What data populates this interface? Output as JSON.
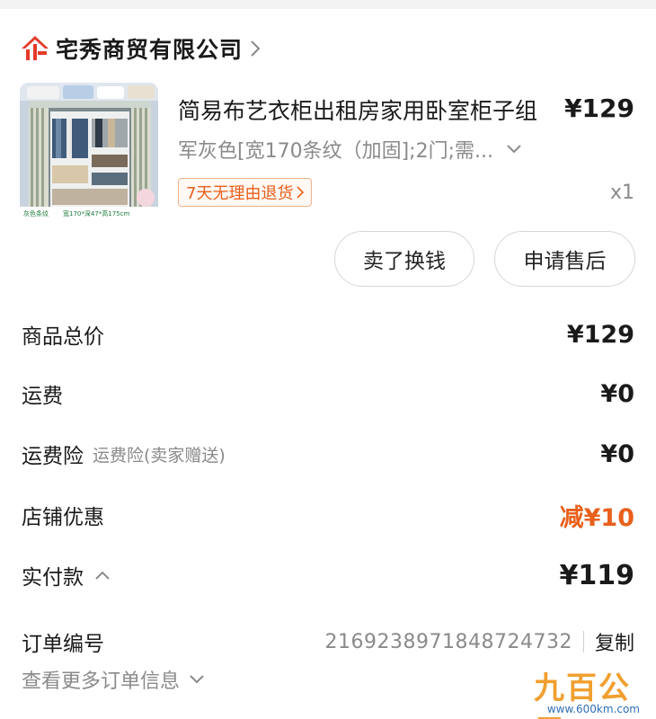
{
  "shop": {
    "name": "宅秀商贸有限公司",
    "icon": "enterprise-icon",
    "icon_color": "#e53a2a"
  },
  "product": {
    "title": "简易布艺衣柜出租房家用卧室柜子组",
    "price": "¥129",
    "spec": "军灰色[宽170条纹（加固];2门;需...",
    "return_badge": "7天无理由退货",
    "quantity": "x1",
    "thumb_caption_left": "灰色条纹",
    "thumb_caption_right": "宽170*深47*高175cm"
  },
  "actions": {
    "sell_label": "卖了换钱",
    "service_label": "申请售后"
  },
  "summary": {
    "goods_total_label": "商品总价",
    "goods_total_value": "¥129",
    "shipping_label": "运费",
    "shipping_value": "¥0",
    "insurance_label": "运费险",
    "insurance_sub": "运费险(卖家赠送)",
    "insurance_value": "¥0",
    "shop_discount_label": "店铺优惠",
    "shop_discount_value": "减¥10",
    "paid_label": "实付款",
    "paid_value": "¥119"
  },
  "order": {
    "number_label": "订单编号",
    "number_value": "2169238971848724732",
    "copy_label": "复制",
    "more_label": "查看更多订单信息"
  },
  "watermark": {
    "main": "九百公里",
    "url": "www.600km.com"
  },
  "colors": {
    "accent_orange": "#e8601c",
    "text_primary": "#1a1a1a",
    "text_secondary": "#8a8a8a",
    "button_border": "#d6d6d6"
  }
}
